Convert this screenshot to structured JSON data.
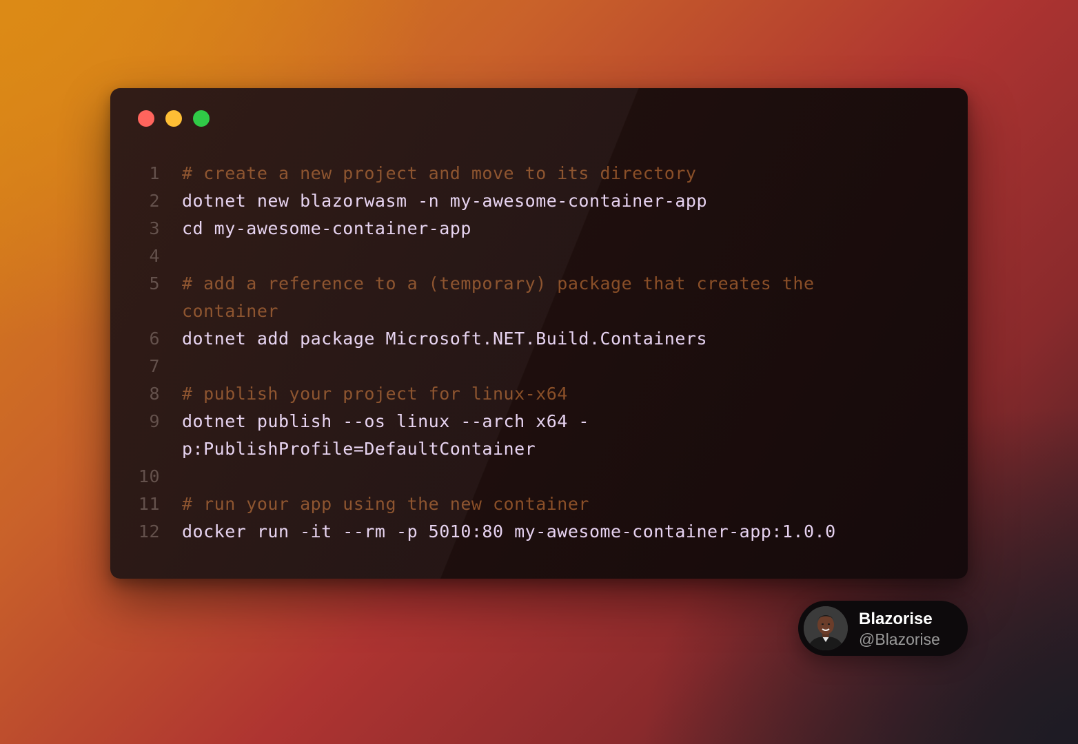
{
  "window": {
    "controls": [
      "close",
      "minimize",
      "zoom"
    ],
    "colors": {
      "close": "#ff5f57",
      "minimize": "#febc2e",
      "zoom": "#28c840"
    }
  },
  "code": {
    "lines": [
      {
        "number": "1",
        "text": "# create a new project and move to its directory",
        "type": "comment"
      },
      {
        "number": "2",
        "text": "dotnet new blazorwasm -n my-awesome-container-app",
        "type": "cmd"
      },
      {
        "number": "3",
        "text": "cd my-awesome-container-app",
        "type": "cmd"
      },
      {
        "number": "4",
        "text": "",
        "type": "cmd"
      },
      {
        "number": "5",
        "text": "# add a reference to a (temporary) package that creates the",
        "type": "comment"
      },
      {
        "number": "",
        "text": "container",
        "type": "comment"
      },
      {
        "number": "6",
        "text": "dotnet add package Microsoft.NET.Build.Containers",
        "type": "cmd"
      },
      {
        "number": "7",
        "text": "",
        "type": "cmd"
      },
      {
        "number": "8",
        "text": "# publish your project for linux-x64",
        "type": "comment"
      },
      {
        "number": "9",
        "text": "dotnet publish --os linux --arch x64 -",
        "type": "cmd"
      },
      {
        "number": "",
        "text": "p:PublishProfile=DefaultContainer",
        "type": "cmd"
      },
      {
        "number": "10",
        "text": "",
        "type": "cmd"
      },
      {
        "number": "11",
        "text": "# run your app using the new container",
        "type": "comment"
      },
      {
        "number": "12",
        "text": "docker run -it --rm -p 5010:80 my-awesome-container-app:1.0.0",
        "type": "cmd"
      }
    ]
  },
  "author": {
    "name": "Blazorise",
    "handle": "@Blazorise",
    "avatar_icon": "person-avatar"
  }
}
